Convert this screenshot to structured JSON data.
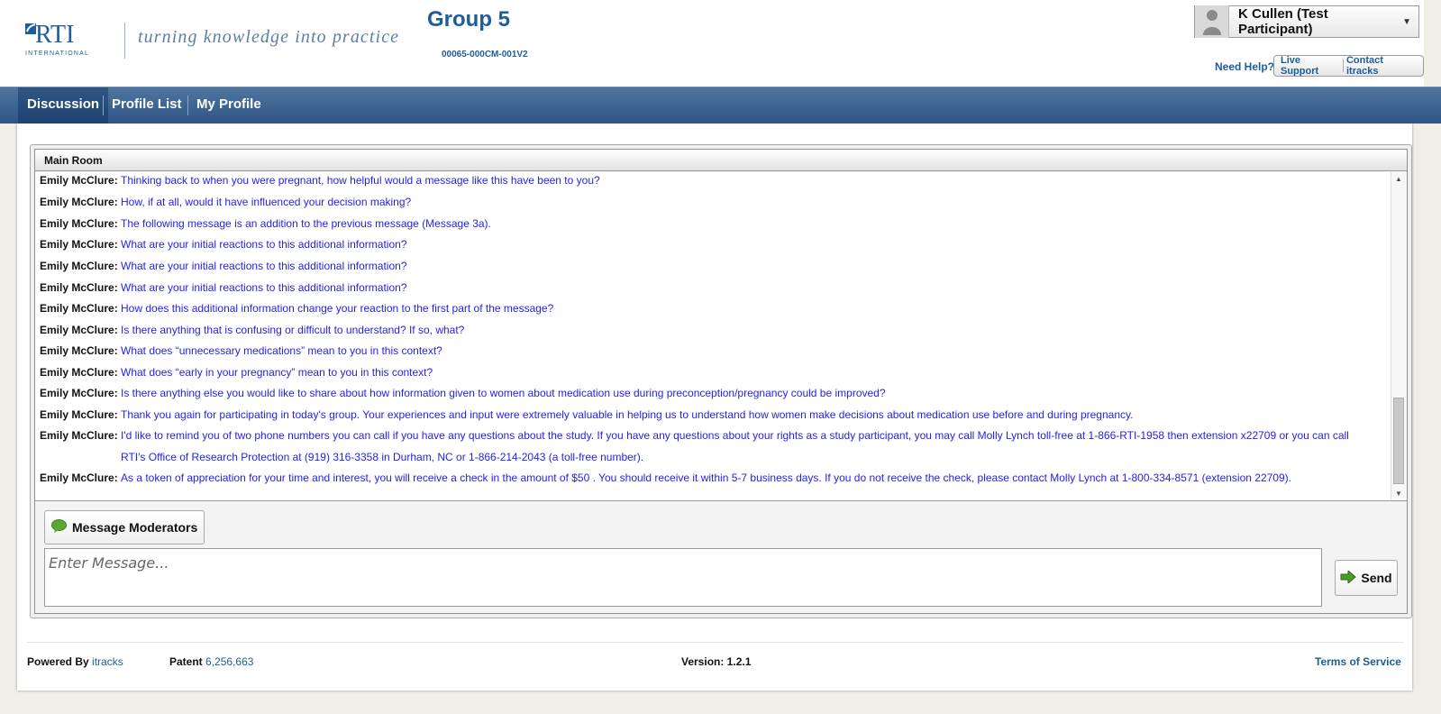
{
  "brand": {
    "logo_text": "RTI",
    "logo_subtext": "INTERNATIONAL",
    "tagline": "turning knowledge into practice"
  },
  "group": {
    "title": "Group 5",
    "code": "00065-000CM-001V2"
  },
  "user": {
    "name": "K Cullen (Test Participant)"
  },
  "help": {
    "label": "Need Help?",
    "live_support": "Live Support",
    "contact": "Contact itracks"
  },
  "nav": {
    "items": [
      {
        "label": "Discussion",
        "active": true
      },
      {
        "label": "Profile List",
        "active": false
      },
      {
        "label": "My Profile",
        "active": false
      }
    ]
  },
  "room": {
    "title": "Main Room",
    "messages": [
      {
        "author": "Emily McClure:",
        "text": "Thinking back to when you were pregnant, how helpful would a message like this have been to you?"
      },
      {
        "author": "Emily McClure:",
        "text": "How, if at all, would it have influenced your decision making?"
      },
      {
        "author": "Emily McClure:",
        "text": "The following message is an addition to the previous message (Message 3a)."
      },
      {
        "author": "Emily McClure:",
        "text": "What are your initial reactions to this additional information?"
      },
      {
        "author": "Emily McClure:",
        "text": "What are your initial reactions to this additional information?"
      },
      {
        "author": "Emily McClure:",
        "text": "What are your initial reactions to this additional information?"
      },
      {
        "author": "Emily McClure:",
        "text": "How does this additional information change your reaction to the first part of the message?"
      },
      {
        "author": "Emily McClure:",
        "text": "Is there anything that is confusing or difficult to understand? If so, what?"
      },
      {
        "author": "Emily McClure:",
        "text": "What does “unnecessary medications” mean to you in this context?"
      },
      {
        "author": "Emily McClure:",
        "text": "What does “early in your pregnancy” mean to you in this context?"
      },
      {
        "author": "Emily McClure:",
        "text": "Is there anything else you would like to share about how information given to women about medication use during preconception/pregnancy could be improved?"
      },
      {
        "author": "Emily McClure:",
        "text": "Thank you again for participating in today's group. Your experiences and input were extremely valuable in helping us to understand how women make decisions about medication use before and during pregnancy."
      },
      {
        "author": "Emily McClure:",
        "text": "I'd like to remind you of two phone numbers you can call if you have any questions about the study. If you have any questions about your rights as a study participant, you may call Molly Lynch toll-free at 1-866-RTI-1958 then extension x22709 or you can call RTI's Office of Research Protection at (919) 316-3358 in Durham, NC or 1-866-214-2043 (a toll-free number)."
      },
      {
        "author": "Emily McClure:",
        "text": "As a token of appreciation for your time and interest, you will receive a check in the amount of $50 . You should receive it within 5-7 business days. If you do not receive the check, please contact Molly Lynch at 1-800-334-8571 (extension 22709)."
      }
    ]
  },
  "composer": {
    "moderators_button": "Message Moderators",
    "placeholder": "Enter Message...",
    "send_button": "Send"
  },
  "footer": {
    "powered_label": "Powered By",
    "powered_link": "itracks",
    "patent_label": "Patent",
    "patent_number": "6,256,663",
    "version": "Version: 1.2.1",
    "terms": "Terms of Service"
  },
  "colors": {
    "brand_blue": "#1d5d99",
    "nav_blue": "#2e5585",
    "message_text": "#2323e8"
  },
  "icons": [
    "user-avatar-icon",
    "chevron-down-icon",
    "chat-bubble-icon",
    "arrow-right-icon",
    "scroll-up-icon",
    "scroll-down-icon"
  ]
}
